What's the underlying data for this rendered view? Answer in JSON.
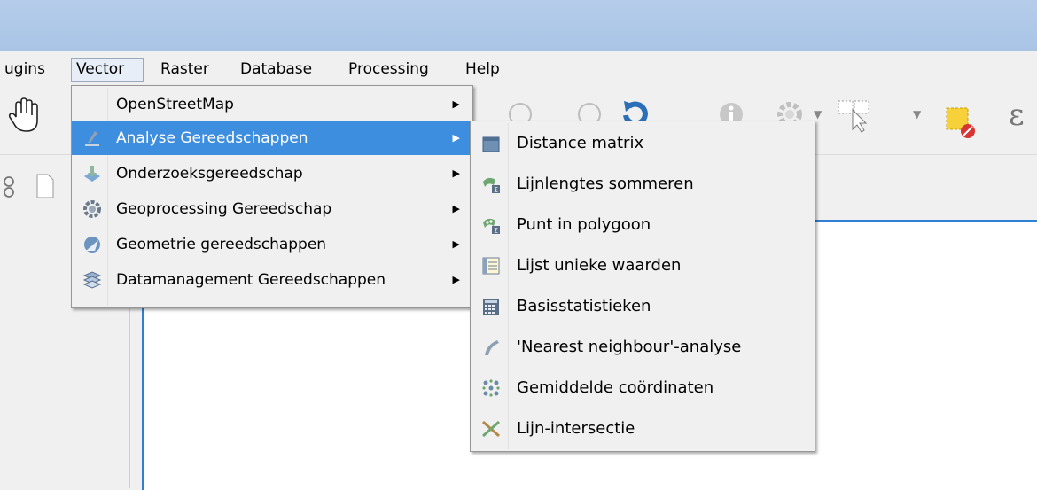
{
  "menubar": {
    "items": [
      "ugins",
      "Vector",
      "Raster",
      "Database",
      "Processing",
      "Help"
    ]
  },
  "vector_menu": {
    "items": [
      {
        "label": "OpenStreetMap",
        "icon": "none"
      },
      {
        "label": "Analyse Gereedschappen",
        "icon": "analysis-icon"
      },
      {
        "label": "Onderzoeksgereedschap",
        "icon": "research-icon"
      },
      {
        "label": "Geoprocessing Gereedschap",
        "icon": "geoprocessing-icon"
      },
      {
        "label": "Geometrie gereedschappen",
        "icon": "geometry-icon"
      },
      {
        "label": "Datamanagement Gereedschappen",
        "icon": "datamanagement-icon"
      }
    ],
    "highlighted": "Analyse Gereedschappen"
  },
  "analysis_submenu": {
    "items": [
      {
        "label": "Distance matrix",
        "icon": "distance-matrix-icon"
      },
      {
        "label": "Lijnlengtes sommeren",
        "icon": "sum-line-lengths-icon"
      },
      {
        "label": "Punt in polygoon",
        "icon": "point-in-polygon-icon"
      },
      {
        "label": "Lijst unieke waarden",
        "icon": "unique-values-icon"
      },
      {
        "label": "Basisstatistieken",
        "icon": "basic-statistics-icon"
      },
      {
        "label": "'Nearest neighbour'-analyse",
        "icon": "nearest-neighbour-icon"
      },
      {
        "label": "Gemiddelde coördinaten",
        "icon": "mean-coordinates-icon"
      },
      {
        "label": "Lijn-intersectie",
        "icon": "line-intersection-icon"
      }
    ]
  },
  "colors": {
    "highlight": "#3e8ee0",
    "titlebar": "#b5cdea",
    "canvas_border": "#2f7fd6"
  }
}
